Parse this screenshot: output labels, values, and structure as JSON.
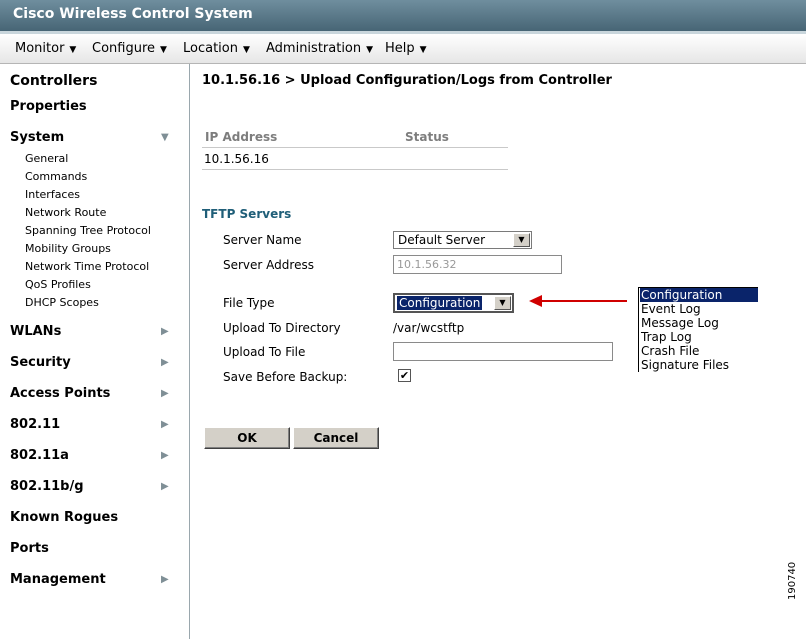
{
  "app": {
    "title": "Cisco Wireless Control System"
  },
  "menu": [
    {
      "label": "Monitor"
    },
    {
      "label": "Configure"
    },
    {
      "label": "Location"
    },
    {
      "label": "Administration"
    },
    {
      "label": "Help"
    }
  ],
  "sidebar": {
    "controllers": "Controllers",
    "properties": "Properties",
    "system": "System",
    "system_items": [
      "General",
      "Commands",
      "Interfaces",
      "Network Route",
      "Spanning Tree Protocol",
      "Mobility Groups",
      "Network Time Protocol",
      "QoS Profiles",
      "DHCP Scopes"
    ],
    "wlans": "WLANs",
    "security": "Security",
    "access_points": "Access Points",
    "n80211": "802.11",
    "n80211a": "802.11a",
    "n80211bg": "802.11b/g",
    "known_rogues": "Known Rogues",
    "ports": "Ports",
    "management": "Management"
  },
  "page": {
    "title": "10.1.56.16 > Upload Configuration/Logs from Controller"
  },
  "table": {
    "headers": [
      "IP Address",
      "Status"
    ],
    "rows": [
      [
        "10.1.56.16",
        ""
      ]
    ]
  },
  "tftp": {
    "section": "TFTP Servers",
    "server_name_label": "Server Name",
    "server_name_value": "Default Server",
    "server_address_label": "Server Address",
    "server_address_value": "10.1.56.32",
    "file_type_label": "File Type",
    "file_type_value": "Configuration",
    "upload_dir_label": "Upload To Directory",
    "upload_dir_value": "/var/wcstftp",
    "upload_file_label": "Upload To File",
    "upload_file_value": "",
    "save_label": "Save Before Backup:",
    "save_checked": "✔"
  },
  "buttons": {
    "ok": "OK",
    "cancel": "Cancel"
  },
  "dropdown": {
    "options": [
      "Configuration",
      "Event Log",
      "Message Log",
      "Trap Log",
      "Crash File",
      "Signature Files"
    ],
    "selected": 0
  },
  "figure_id": "190740",
  "colors": {
    "title_bar": "#476575",
    "section": "#1f5e78",
    "arrow": "#d00000",
    "selection": "#0a246a"
  }
}
